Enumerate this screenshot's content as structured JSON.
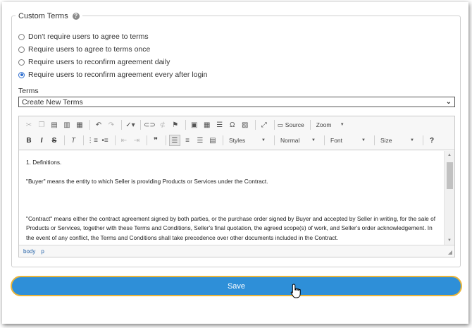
{
  "section": {
    "legend": "Custom Terms",
    "help_icon": "question-circle-icon"
  },
  "agreement_options": [
    {
      "label": "Don't require users to agree to terms",
      "checked": false
    },
    {
      "label": "Require users to agree to terms once",
      "checked": false
    },
    {
      "label": "Require users to reconfirm agreement daily",
      "checked": false
    },
    {
      "label": "Require users to reconfirm agreement every after login",
      "checked": true
    }
  ],
  "terms": {
    "label": "Terms",
    "selected": "Create New Terms"
  },
  "toolbar": {
    "row1": {
      "source_label": "Source",
      "zoom_label": "Zoom"
    },
    "row2": {
      "styles_label": "Styles",
      "format_label": "Normal",
      "font_label": "Font",
      "size_label": "Size"
    },
    "glyphs": {
      "bold": "B",
      "italic": "I",
      "strike": "S",
      "clear": "T",
      "omega": "Ω",
      "blockquote": "❞",
      "help": "?"
    }
  },
  "editor_content": {
    "paragraphs": [
      "1. Definitions.",
      "\"Buyer\" means the entity to which Seller is providing Products or Services under the Contract.",
      "",
      "\"Contract\" means either the contract agreement signed by both parties, or the purchase order signed by Buyer and accepted by Seller in writing, for the sale of Products or Services, together with these Terms and Conditions, Seller's final quotation, the agreed scope(s) of work, and Seller's order acknowledgement. In the event of any conflict, the Terms and Conditions shall take precedence over other documents included in the Contract."
    ]
  },
  "statusbar": {
    "path": [
      "body",
      "p"
    ]
  },
  "save_button": {
    "label": "Save"
  },
  "colors": {
    "accent": "#2e8fd8",
    "button_border": "#e8b43a",
    "radio_checked": "#2f6fd0"
  }
}
